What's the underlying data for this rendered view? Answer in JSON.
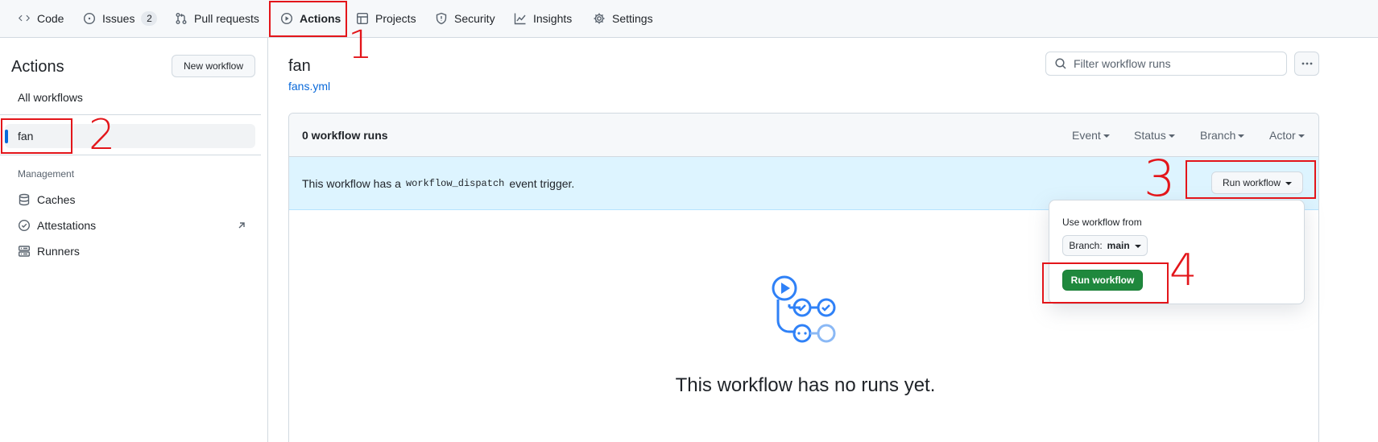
{
  "nav": {
    "tabs": [
      {
        "label": "Code",
        "icon": "code-icon"
      },
      {
        "label": "Issues",
        "icon": "issue-icon",
        "count": "2"
      },
      {
        "label": "Pull requests",
        "icon": "pull-request-icon"
      },
      {
        "label": "Actions",
        "icon": "play-icon",
        "active": true
      },
      {
        "label": "Projects",
        "icon": "table-icon"
      },
      {
        "label": "Security",
        "icon": "shield-icon"
      },
      {
        "label": "Insights",
        "icon": "graph-icon"
      },
      {
        "label": "Settings",
        "icon": "gear-icon"
      }
    ]
  },
  "sidebar": {
    "title": "Actions",
    "new_workflow": "New workflow",
    "all_workflows": "All workflows",
    "selected_workflow": "fan",
    "management_heading": "Management",
    "management_items": [
      {
        "label": "Caches",
        "icon": "database-icon"
      },
      {
        "label": "Attestations",
        "icon": "verified-icon",
        "external": true
      },
      {
        "label": "Runners",
        "icon": "server-icon"
      }
    ]
  },
  "main": {
    "workflow_name": "fan",
    "workflow_file": "fans.yml",
    "filter_placeholder": "Filter workflow runs",
    "runs_count": "0 workflow runs",
    "filters": [
      "Event",
      "Status",
      "Branch",
      "Actor"
    ],
    "dispatch_prefix": "This workflow has a",
    "dispatch_code": "workflow_dispatch",
    "dispatch_suffix": "event trigger.",
    "run_workflow_button": "Run workflow",
    "empty_title": "This workflow has no runs yet."
  },
  "popover": {
    "label": "Use workflow from",
    "branch_prefix": "Branch:",
    "branch_name": "main",
    "run_button": "Run workflow"
  },
  "annotations": [
    "1",
    "2",
    "3",
    "4"
  ],
  "colors": {
    "annotation": "#e3151a",
    "accent_blue": "#0969da",
    "run_green": "#1f883d",
    "dispatch_bg": "#ddf4ff"
  }
}
